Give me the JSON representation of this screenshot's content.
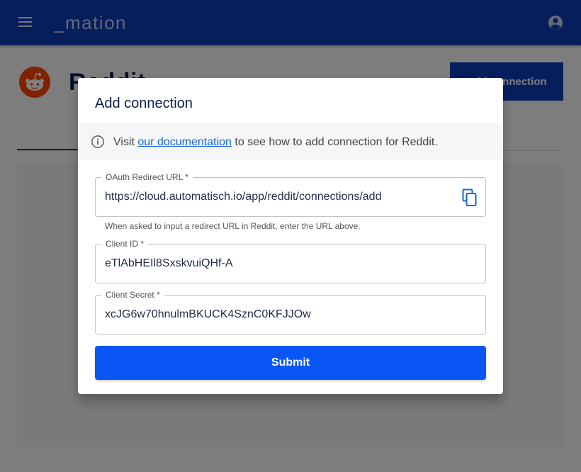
{
  "appbar": {
    "brand": "_mation",
    "menu_icon": "hamburger-menu-icon",
    "account_icon": "account-circle-icon"
  },
  "page": {
    "title": "Reddit",
    "add_connection_label": "Add connection",
    "logo_icon": "reddit-logo"
  },
  "dialog": {
    "title": "Add connection",
    "info": {
      "icon": "info-circle-icon",
      "prefix": "Visit ",
      "link_text": "our documentation",
      "suffix": " to see how to add connection for Reddit."
    },
    "fields": {
      "redirect_url": {
        "label": "OAuth Redirect URL *",
        "value": "https://cloud.automatisch.io/app/reddit/connections/add",
        "helper": "When asked to input a redirect URL in Reddit, enter the URL above.",
        "copy_icon": "copy-icon"
      },
      "client_id": {
        "label": "Client ID *",
        "value": "eTlAbHEIl8SxskvuiQHf-A"
      },
      "client_secret": {
        "label": "Client Secret *",
        "value": "xcJG6w70hnulmBKUCK4SznC0KFJJOw"
      }
    },
    "submit_label": "Submit"
  },
  "colors": {
    "appbar": "#0d3cb8",
    "primary_button": "#0a56f5",
    "link": "#1565d8",
    "reddit_orange": "#ff4500"
  }
}
